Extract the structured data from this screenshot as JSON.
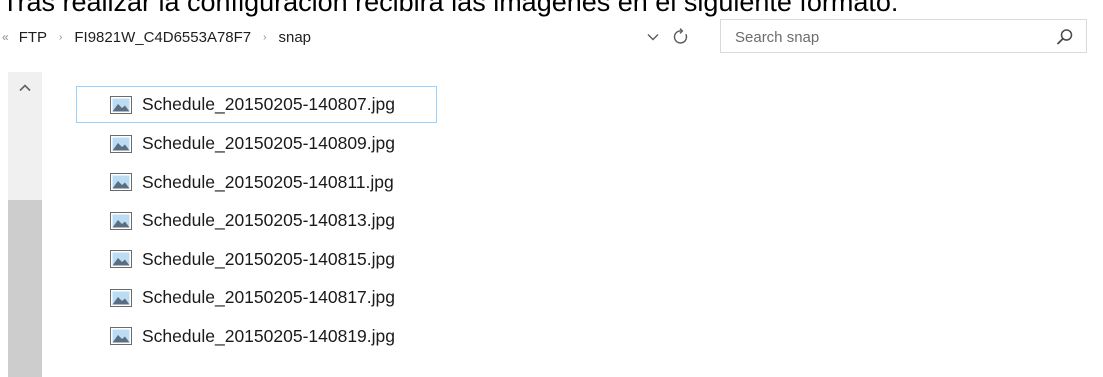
{
  "caption": "Tras realizar la configuración recibirá las imágenes en el siguiente formato:",
  "breadcrumb": {
    "overflow": "«",
    "separator": "›",
    "items": [
      "FTP",
      "FI9821W_C4D6553A78F7",
      "snap"
    ]
  },
  "search": {
    "placeholder": "Search snap",
    "value": ""
  },
  "icons": {
    "dropdown": "chevron-down-icon",
    "refresh": "refresh-icon",
    "search": "search-icon",
    "scroll_up": "chevron-up-icon",
    "file": "image-file-icon"
  },
  "files": [
    "Schedule_20150205-140807.jpg",
    "Schedule_20150205-140809.jpg",
    "Schedule_20150205-140811.jpg",
    "Schedule_20150205-140813.jpg",
    "Schedule_20150205-140815.jpg",
    "Schedule_20150205-140817.jpg",
    "Schedule_20150205-140819.jpg"
  ],
  "colors": {
    "focus_outline": "#99d1ff",
    "scrollbar_track": "#f0f0f0",
    "scrollbar_thumb": "#cdcdcd",
    "search_border": "#d9d9d9"
  }
}
